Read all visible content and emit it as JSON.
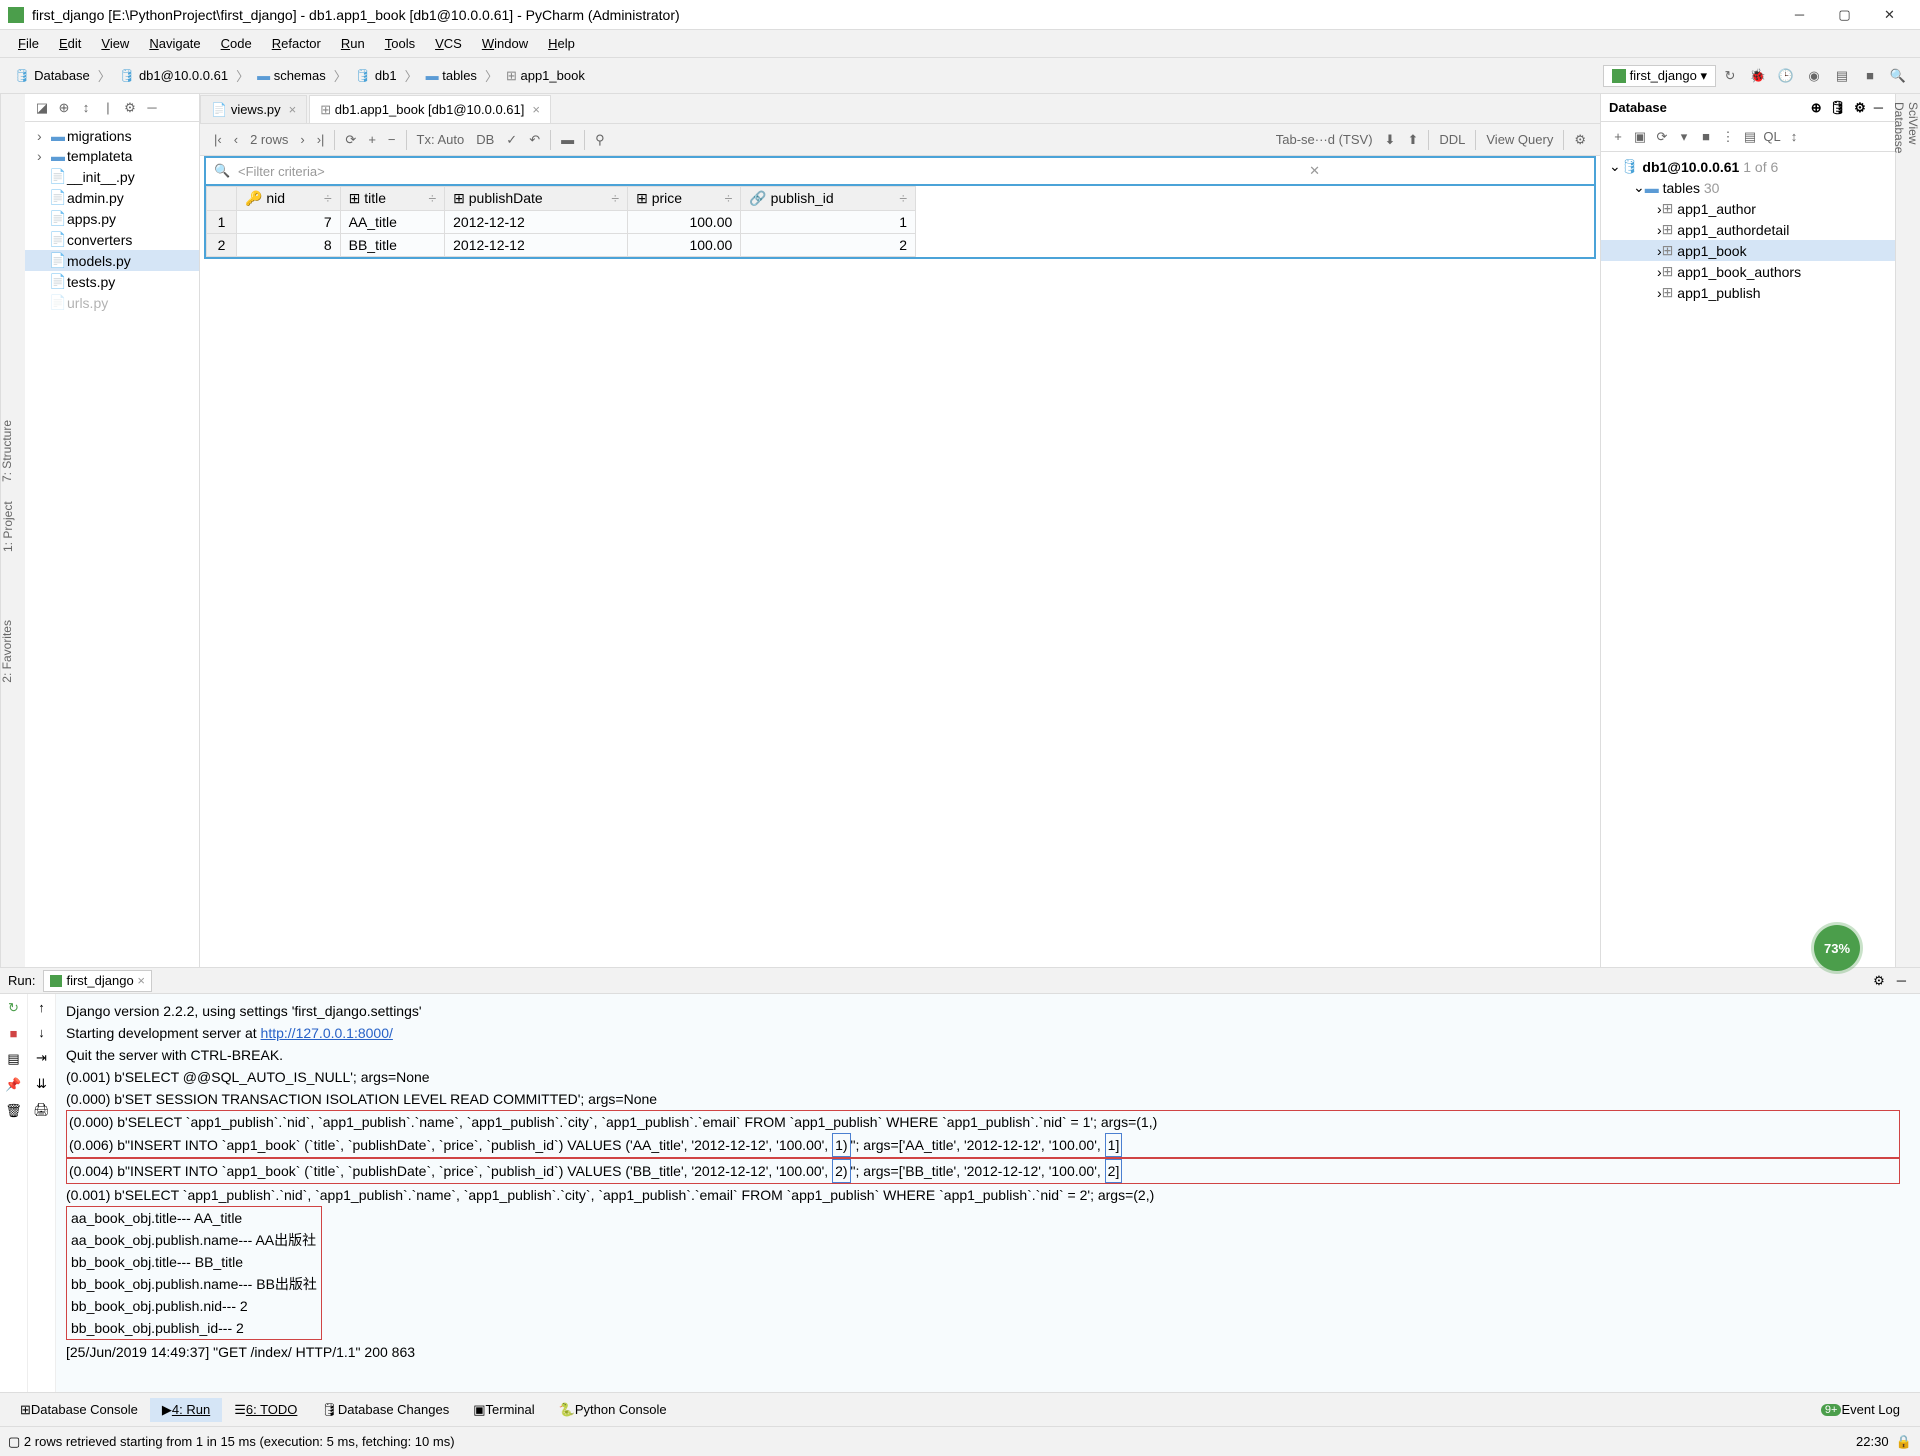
{
  "window": {
    "title": "first_django [E:\\PythonProject\\first_django] - db1.app1_book [db1@10.0.0.61] - PyCharm (Administrator)"
  },
  "menu": [
    "File",
    "Edit",
    "View",
    "Navigate",
    "Code",
    "Refactor",
    "Run",
    "Tools",
    "VCS",
    "Window",
    "Help"
  ],
  "breadcrumb": [
    "Database",
    "db1@10.0.0.61",
    "schemas",
    "db1",
    "tables",
    "app1_book"
  ],
  "runconfig": "first_django",
  "project": {
    "files": [
      {
        "label": "migrations",
        "type": "folder",
        "exp": ">"
      },
      {
        "label": "templateta",
        "type": "folder",
        "exp": ">"
      },
      {
        "label": "__init__.py",
        "type": "py"
      },
      {
        "label": "admin.py",
        "type": "py"
      },
      {
        "label": "apps.py",
        "type": "py"
      },
      {
        "label": "converters",
        "type": "py"
      },
      {
        "label": "models.py",
        "type": "py",
        "sel": true
      },
      {
        "label": "tests.py",
        "type": "py"
      },
      {
        "label": "urls.py",
        "type": "py"
      }
    ]
  },
  "editor_tabs": [
    {
      "label": "views.py",
      "active": false
    },
    {
      "label": "db1.app1_book [db1@10.0.0.61]",
      "active": true
    }
  ],
  "db_toolbar": {
    "rows": "2 rows",
    "tx": "Tx: Auto",
    "tab_sep": "Tab-se···d (TSV)",
    "ddl": "DDL",
    "view_query": "View Query"
  },
  "filter_placeholder": "<Filter criteria>",
  "grid": {
    "cols": [
      "nid",
      "title",
      "publishDate",
      "price",
      "publish_id"
    ],
    "rows": [
      {
        "n": "1",
        "nid": "7",
        "title": "AA_title",
        "publishDate": "2012-12-12",
        "price": "100.00",
        "publish_id": "1"
      },
      {
        "n": "2",
        "nid": "8",
        "title": "BB_title",
        "publishDate": "2012-12-12",
        "price": "100.00",
        "publish_id": "2"
      }
    ]
  },
  "db_panel": {
    "title": "Database",
    "ds": "db1@10.0.0.61",
    "ds_count": "1 of 6",
    "tables_label": "tables",
    "tables_count": "30",
    "tables": [
      "app1_author",
      "app1_authordetail",
      "app1_book",
      "app1_book_authors",
      "app1_publish"
    ]
  },
  "run": {
    "label": "Run:",
    "tab": "first_django",
    "lines": {
      "l1": "Django version 2.2.2, using settings 'first_django.settings'",
      "l2a": "Starting development server at ",
      "l2b": "http://127.0.0.1:8000/",
      "l3": "Quit the server with CTRL-BREAK.",
      "l4": "(0.001) b'SELECT @@SQL_AUTO_IS_NULL'; args=None",
      "l5": "(0.000) b'SET SESSION TRANSACTION ISOLATION LEVEL READ COMMITTED'; args=None",
      "l6": "(0.000) b'SELECT `app1_publish`.`nid`, `app1_publish`.`name`, `app1_publish`.`city`, `app1_publish`.`email` FROM `app1_publish` WHERE `app1_publish`.`nid` = 1'; args=(1,)",
      "l7a": "(0.006) b\"INSERT INTO `app1_book` (`title`, `publishDate`, `price`, `publish_id`) VALUES ('AA_title', '2012-12-12', '100.00', ",
      "l7b": "1)",
      "l7c": "\"; args=['AA_title', '2012-12-12', '100.00', ",
      "l7d": "1]",
      "l8a": "(0.004) b\"INSERT INTO `app1_book` (`title`, `publishDate`, `price`, `publish_id`) VALUES ('BB_title', '2012-12-12', '100.00', ",
      "l8b": "2)",
      "l8c": "\"; args=['BB_title', '2012-12-12', '100.00', ",
      "l8d": "2]",
      "l9": "(0.001) b'SELECT `app1_publish`.`nid`, `app1_publish`.`name`, `app1_publish`.`city`, `app1_publish`.`email` FROM `app1_publish` WHERE `app1_publish`.`nid` = 2'; args=(2,)",
      "l10": "aa_book_obj.title--- AA_title",
      "l11": "aa_book_obj.publish.name--- AA出版社",
      "l12": "bb_book_obj.title--- BB_title",
      "l13": "bb_book_obj.publish.name--- BB出版社",
      "l14": "bb_book_obj.publish.nid--- 2",
      "l15": "bb_book_obj.publish_id--- 2",
      "l16": "[25/Jun/2019 14:49:37] \"GET /index/ HTTP/1.1\" 200 863"
    }
  },
  "bottombar": {
    "dbconsole": "Database Console",
    "run": "4: Run",
    "todo": "6: TODO",
    "dbchanges": "Database Changes",
    "terminal": "Terminal",
    "pyconsole": "Python Console",
    "eventlog": "Event Log"
  },
  "status": {
    "msg": "2 rows retrieved starting from 1 in 15 ms (execution: 5 ms, fetching: 10 ms)",
    "time": "22:30"
  },
  "left_gutter": "1: Project",
  "right_gutter1": "SciView",
  "right_gutter2": "Database",
  "left_gutter2": "7: Structure",
  "left_gutter3": "2: Favorites",
  "badge": "73%"
}
